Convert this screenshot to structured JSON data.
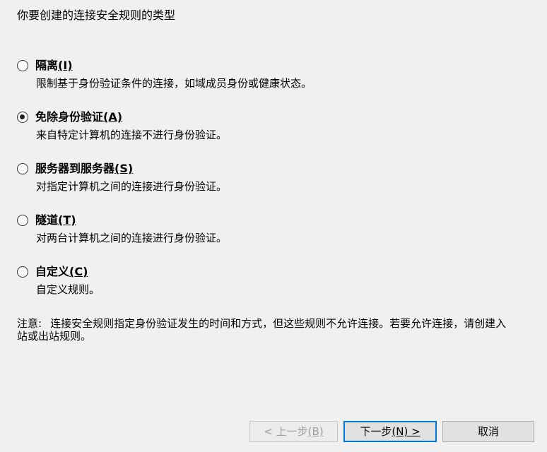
{
  "prompt": "你要创建的连接安全规则的类型",
  "options": [
    {
      "title": "隔离",
      "key": "(I)",
      "description": "限制基于身份验证条件的连接，如域成员身份或健康状态。",
      "selected": false
    },
    {
      "title": "免除身份验证",
      "key": "(A)",
      "description": "来自特定计算机的连接不进行身份验证。",
      "selected": true
    },
    {
      "title": "服务器到服务器",
      "key": "(S)",
      "description": "对指定计算机之间的连接进行身份验证。",
      "selected": false
    },
    {
      "title": "隧道",
      "key": "(T)",
      "description": "对两台计算机之间的连接进行身份验证。",
      "selected": false
    },
    {
      "title": "自定义",
      "key": "(C)",
      "description": "自定义规则。",
      "selected": false
    }
  ],
  "note": {
    "label": "注意:",
    "text": "连接安全规则指定身份验证发生的时间和方式，但这些规则不允许连接。若要允许连接，请创建入站或出站规则。"
  },
  "buttons": {
    "back": {
      "label": "< 上一步",
      "key": "(B)"
    },
    "next": {
      "label": "下一步",
      "key": "(N) >"
    },
    "cancel": {
      "label": "取消"
    }
  }
}
